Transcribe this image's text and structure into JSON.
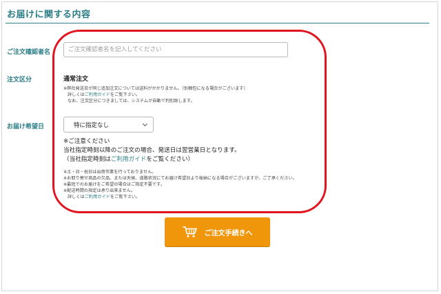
{
  "section": {
    "title": "お届けに関する内容"
  },
  "orderer_name": {
    "label": "ご注文確認者名",
    "placeholder": "ご注文確認者名を記入してください",
    "value": ""
  },
  "order_type": {
    "label": "注文区分",
    "value": "通常注文",
    "notes": {
      "line1": "※弊社発送日が同じ追加注文については送料がかかりません。（別梱包になる場合がございます）",
      "line2_prefix": "詳しくは",
      "line2_link": "ご利用ガイド",
      "line2_suffix": "をご覧下さい。",
      "line3": "なお、注文区分につきましては、システムが自動で判別致します。"
    }
  },
  "delivery_date": {
    "label": "お届け希望日",
    "selected": "特に指定なし",
    "notice_heading": "※ご注意ください",
    "notice_line1": "当社指定時刻以降のご注文の場合、発送日は翌営業日となります。",
    "notice_line2_prefix": "（当社指定時刻は",
    "notice_line2_link": "ご利用ガイド",
    "notice_line2_suffix": "をご覧ください）",
    "notes": {
      "line1": "※土・日・祝日は出荷作業を行っておりません。",
      "line2": "※お取り寄せ商品の欠品、または天候、道路状況にてお届け希望日より後納になる場合がございますが、ご了承ください。",
      "line3": "※最短でのお届けをご希望の場合はご指定不要です。",
      "line4": "※配送時間の指定は承り出来ません。",
      "line5_prefix": "詳しくは",
      "line5_link": "ご利用ガイド",
      "line5_suffix": "をご覧下さい。"
    }
  },
  "checkout_button": {
    "label": "ご注文手続きへ",
    "icon": "cart-icon"
  },
  "colors": {
    "accent": "#2a7d86",
    "highlight": "#e0141e",
    "button": "#f0960a"
  }
}
